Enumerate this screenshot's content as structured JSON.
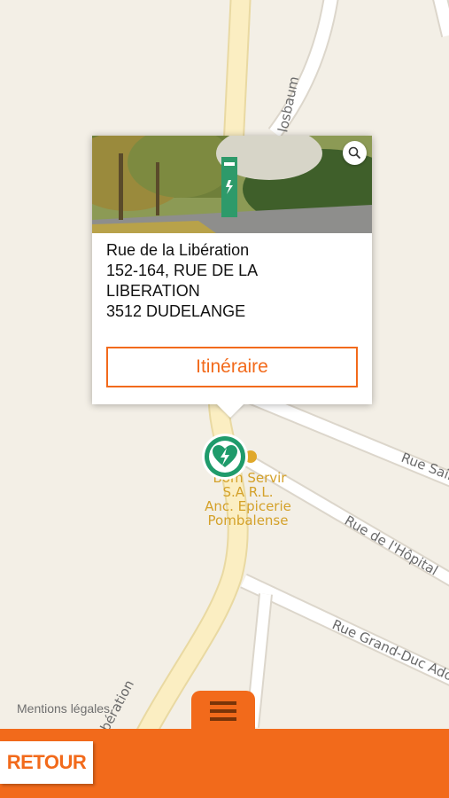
{
  "map": {
    "streets": {
      "top": "losbaum",
      "right_1": "Rue Sain",
      "right_2": "Rue de l'Hôpital",
      "right_3": "Rue Grand-Duc Adolp",
      "bottom": "bération"
    },
    "poi": {
      "line1": "Bom Servir",
      "line2": "S.A R.L.",
      "line3": "Anc. Epicerie",
      "line4": "Pombalense"
    },
    "legal_link": "Mentions légales"
  },
  "popup": {
    "street_name": "Rue de la Libération",
    "address_line1": "152-164, RUE DE LA",
    "address_line2": "LIBERATION",
    "city_line": "3512 DUDELANGE",
    "itinerary_label": "Itinéraire",
    "zoom_icon": "magnifier-icon"
  },
  "marker": {
    "icon": "defibrillator-heart-icon",
    "color": "#1f9b6b"
  },
  "bottom_bar": {
    "back_label": "RETOUR",
    "menu_icon": "hamburger-menu-icon",
    "accent_color": "#f26a1b"
  }
}
